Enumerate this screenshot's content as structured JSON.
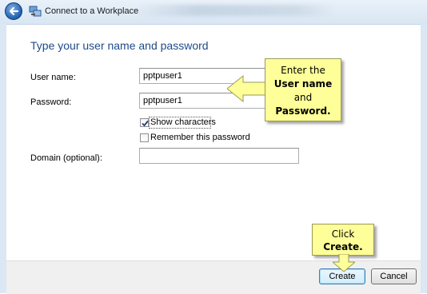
{
  "window": {
    "title": "Connect to a Workplace"
  },
  "main": {
    "heading": "Type your user name and password",
    "username_label": "User name:",
    "username_value": "pptpuser1",
    "password_label": "Password:",
    "password_value": "pptpuser1",
    "show_characters_label": "Show characters",
    "show_characters_checked": true,
    "remember_label": "Remember this password",
    "remember_checked": false,
    "domain_label": "Domain (optional):",
    "domain_value": ""
  },
  "footer": {
    "create_label": "Create",
    "cancel_label": "Cancel"
  },
  "callouts": {
    "enter": {
      "line1": "Enter the",
      "line2": "User name",
      "line3": "and",
      "line4": "Password."
    },
    "click": {
      "line1": "Click",
      "line2": "Create."
    }
  },
  "icons": {
    "back": "back-arrow-icon",
    "window": "network-workplace-icon",
    "check": "checkmark-icon"
  },
  "colors": {
    "heading": "#1e4b8a",
    "callout_bg": "#ffff99",
    "titlebar": "#dbe7f3"
  }
}
